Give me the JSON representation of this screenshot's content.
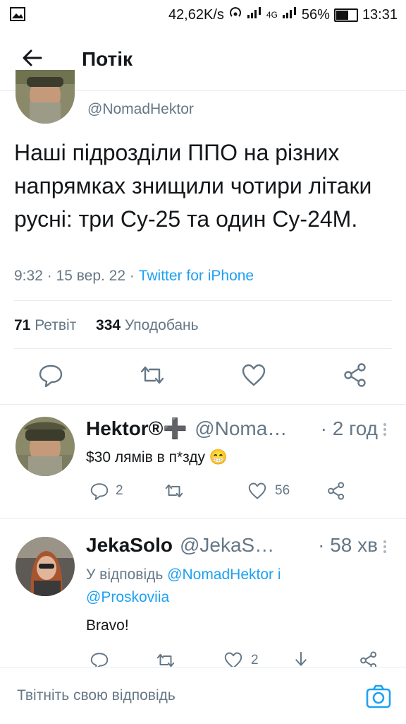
{
  "status_bar": {
    "speed": "42,62K/s",
    "network": "4G",
    "battery": "56%",
    "time": "13:31"
  },
  "appbar": {
    "title": "Потік"
  },
  "main_tweet": {
    "handle": "@NomadHektor",
    "text": "Наші підрозділи ППО на різних напрямках знищили чотири літаки русні: три Су-25 та один Су-24М.",
    "time": "9:32 · 15 вер. 22 · ",
    "source": "Twitter for iPhone",
    "retweets_count": "71",
    "retweets_label": "Ретвіт",
    "likes_count": "334",
    "likes_label": "Уподобань"
  },
  "replies": [
    {
      "name": "Hektor®➕",
      "handle": "@NomadHektor",
      "time": "· 2 год",
      "text": "$30 лямів в п*зду 😁",
      "reply_count": "2",
      "like_count": "56"
    },
    {
      "name": "JekaSolo",
      "handle": "@JekaSolo",
      "time": "· 58 хв",
      "replying_prefix": "У відповідь ",
      "replying_to_1": "@NomadHektor",
      "replying_and": " і",
      "replying_to_2": "@Proskoviia",
      "text": "Bravo!",
      "like_count": "2"
    }
  ],
  "composer": {
    "placeholder": "Твітніть свою відповідь"
  },
  "colors": {
    "accent": "#1da1f2",
    "secondary_text": "#657786",
    "divider": "#e6ecf0"
  }
}
